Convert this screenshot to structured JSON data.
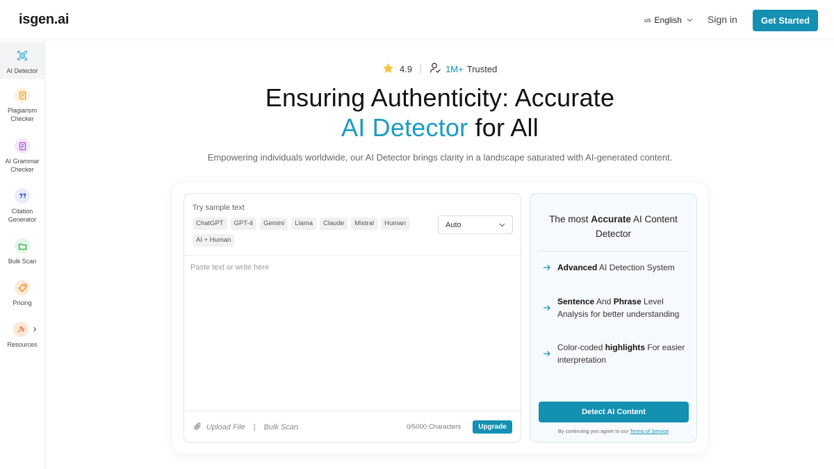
{
  "header": {
    "logo": "isgen.ai",
    "lang_flag": "us",
    "lang_label": "English",
    "signin": "Sign in",
    "get_started": "Get Started"
  },
  "sidebar": {
    "items": [
      {
        "label": "AI Detector",
        "icon": "scan-doc-icon",
        "active": true
      },
      {
        "label": "Plagiarism Checker",
        "icon": "document-check-icon"
      },
      {
        "label": "AI Grammar Checker",
        "icon": "grammar-doc-icon"
      },
      {
        "label": "Citation Generator",
        "icon": "quote-icon"
      },
      {
        "label": "Bulk Scan",
        "icon": "folder-icon"
      },
      {
        "label": "Pricing",
        "icon": "price-tag-icon"
      },
      {
        "label": "Resources",
        "icon": "resources-icon"
      }
    ]
  },
  "hero": {
    "rating": "4.9",
    "users_count": "1M+",
    "users_label": "Trusted",
    "title_line1": "Ensuring Authenticity: Accurate",
    "title_accent": "AI Detector",
    "title_line2_rest": " for All",
    "subtitle": "Empowering individuals worldwide, our AI Detector brings clarity in a landscape saturated with AI-generated content."
  },
  "editor": {
    "sample_label": "Try sample text",
    "chips": [
      "ChatGPT",
      "GPT-4",
      "Gemini",
      "Llama",
      "Claude",
      "Mistral",
      "Human",
      "AI + Human"
    ],
    "select_value": "Auto",
    "placeholder": "Paste text or write here",
    "upload_label": "Upload File",
    "divider": "|",
    "bulk_label": "Bulk Scan",
    "char_count": "0/5000 Characters",
    "upgrade": "Upgrade"
  },
  "panel": {
    "title_pre": "The most ",
    "title_bold": "Accurate",
    "title_post": " AI Content Detector",
    "features": [
      {
        "bold": "Advanced",
        "text": " AI Detection System"
      },
      {
        "bold": "Sentence",
        "text": " And ",
        "bold2": "Phrase",
        "text2": " Level Analysis for better understanding"
      },
      {
        "bold": "",
        "text": "Color-coded ",
        "bold2": "highlights",
        "text2": " For easier interpretation"
      }
    ],
    "detect_button": "Detect AI Content",
    "terms_pre": "By continuing you agree to our ",
    "terms_link": "Terms of Service"
  },
  "colors": {
    "accent": "#1390b2",
    "accent_text": "#1a9cc2"
  }
}
